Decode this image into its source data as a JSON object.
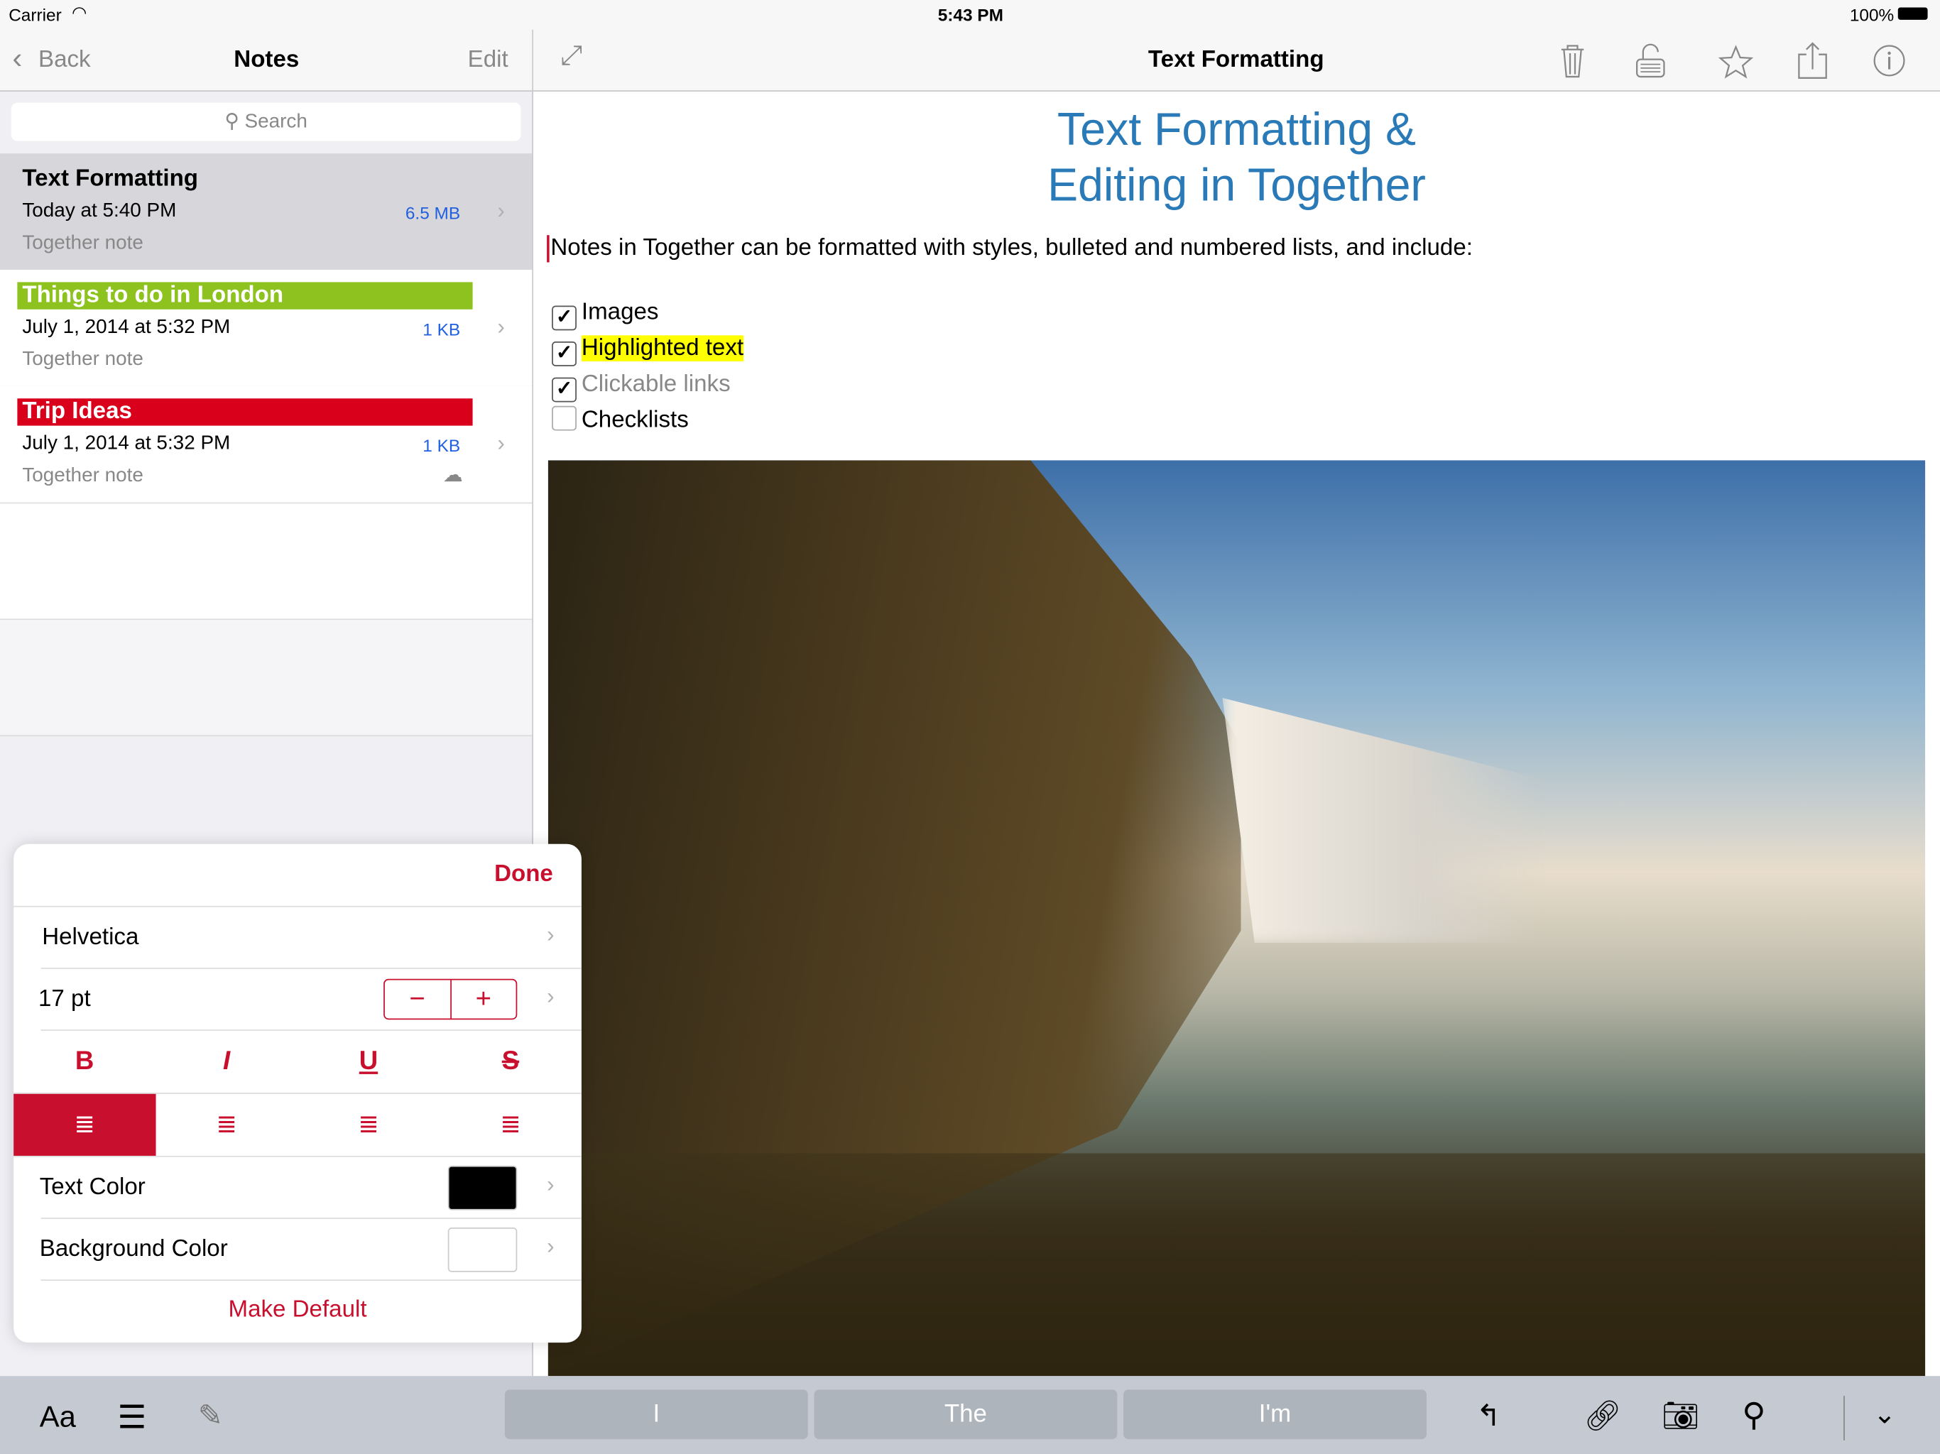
{
  "status": {
    "carrier": "Carrier",
    "time": "5:43 PM",
    "battery": "100%"
  },
  "sidebar": {
    "back": "Back",
    "title": "Notes",
    "edit": "Edit",
    "search_placeholder": "Search",
    "notes": [
      {
        "title": "Text Formatting",
        "date": "Today at 5:40 PM",
        "size": "6.5 MB",
        "type": "Together note",
        "label_color": ""
      },
      {
        "title": "Things to do in London",
        "date": "July 1, 2014 at 5:32 PM",
        "size": "1 KB",
        "type": "Together note",
        "label_color": "#8dc21f"
      },
      {
        "title": "Trip Ideas",
        "date": "July 1, 2014 at 5:32 PM",
        "size": "1 KB",
        "type": "Together note",
        "label_color": "#d9001b"
      }
    ]
  },
  "editor": {
    "title": "Text Formatting",
    "heading_line1": "Text Formatting &",
    "heading_line2": "Editing in Together",
    "intro": "Notes in Together can be formatted with styles, bulleted and numbered lists, and include:",
    "checklist": [
      {
        "label": "Images",
        "checked": true
      },
      {
        "label": "Highlighted text",
        "checked": true
      },
      {
        "label": "Clickable links",
        "checked": true
      },
      {
        "label": "Checklists",
        "checked": false
      }
    ],
    "icons": [
      "expand-icon",
      "trash-icon",
      "lock-icon",
      "star-icon",
      "share-icon",
      "info-icon"
    ]
  },
  "format_panel": {
    "done": "Done",
    "font": "Helvetica",
    "size": "17 pt",
    "bold": "B",
    "italic": "I",
    "underline": "U",
    "strike": "S",
    "alignment_selected": "left",
    "text_color_label": "Text Color",
    "text_color": "#000000",
    "bg_color_label": "Background Color",
    "bg_color": "#ffffff",
    "make_default": "Make Default"
  },
  "keyboard_bar": {
    "format": "Aa",
    "suggestions": [
      "I",
      "The",
      "I'm"
    ]
  },
  "colors": {
    "accent": "#c8102e",
    "heading": "#2a7ab8",
    "highlight": "#ffff00"
  }
}
